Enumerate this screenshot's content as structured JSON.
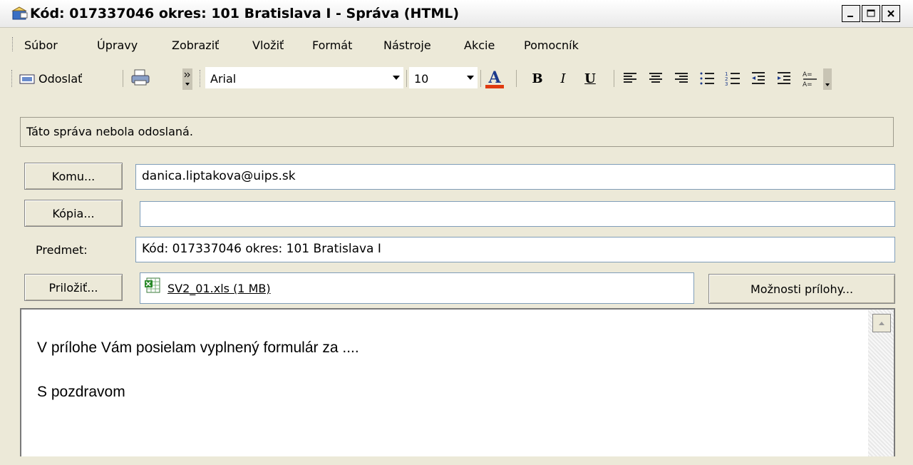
{
  "window": {
    "title": "Kód: 017337046 okres: 101 Bratislava I - Správa (HTML)"
  },
  "menu": {
    "items": [
      "Súbor",
      "Úpravy",
      "Zobraziť",
      "Vložiť",
      "Formát",
      "Nástroje",
      "Akcie",
      "Pomocník"
    ]
  },
  "toolbar": {
    "send_label": "Odoslať",
    "font_name": "Arial",
    "font_size": "10",
    "bold": "B",
    "italic": "I",
    "underline": "U",
    "font_color": "#ff0000"
  },
  "status": {
    "text": "Táto správa nebola odoslaná."
  },
  "fields": {
    "to_button": "Komu...",
    "to_value": "danica.liptakova@uips.sk",
    "cc_button": "Kópia...",
    "cc_value": "",
    "subject_label": "Predmet:",
    "subject_value": "Kód: 017337046 okres: 101 Bratislava I",
    "attach_button": "Priložiť...",
    "attachment_name": "SV2_01.xls (1 MB)",
    "attach_options_button": "Možnosti prílohy..."
  },
  "body": {
    "line1": "V prílohe Vám posielam vyplnený formulár za  ....",
    "line2": "S pozdravom"
  }
}
